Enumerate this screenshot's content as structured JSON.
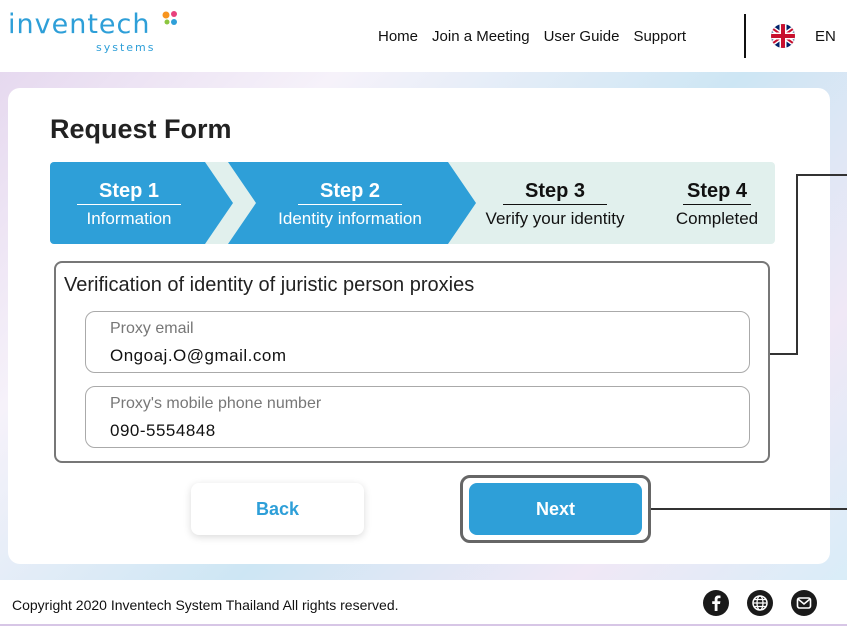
{
  "logo": {
    "text_main": "invent",
    "text_tail": "ech",
    "text_sub": "systems"
  },
  "nav": {
    "items": [
      "Home",
      "Join a Meeting",
      "User Guide",
      "Support"
    ],
    "language": "EN"
  },
  "page": {
    "title": "Request Form"
  },
  "steps": [
    {
      "number": "Step 1",
      "label": "Information",
      "state": "done"
    },
    {
      "number": "Step 2",
      "label": "Identity information",
      "state": "active"
    },
    {
      "number": "Step 3",
      "label": "Verify your identity",
      "state": "pending"
    },
    {
      "number": "Step 4",
      "label": "Completed",
      "state": "pending"
    }
  ],
  "verification": {
    "title": "Verification of identity of juristic person proxies",
    "email": {
      "label": "Proxy email",
      "value": "Ongoaj.O@gmail.com"
    },
    "phone": {
      "label": "Proxy's mobile phone number",
      "value": "090-5554848"
    }
  },
  "buttons": {
    "back": "Back",
    "next": "Next"
  },
  "footer": {
    "copyright": "Copyright  2020 Inventech System Thailand All rights reserved.",
    "icons": [
      "facebook-icon",
      "globe-icon",
      "mail-icon"
    ]
  },
  "colors": {
    "accent": "#2e9fd8",
    "step_bg": "#e1f0ed",
    "logo_dot_orange": "#f7941d",
    "logo_dot_pink": "#e8417d"
  }
}
